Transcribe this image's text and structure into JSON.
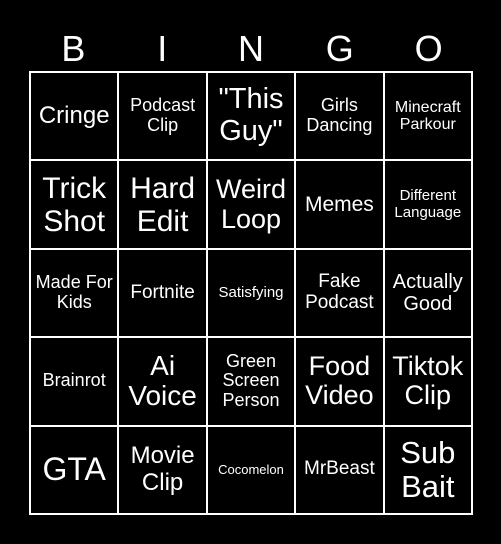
{
  "header": [
    "B",
    "I",
    "N",
    "G",
    "O"
  ],
  "cells": [
    {
      "text": "Cringe",
      "size": 24
    },
    {
      "text": "Podcast Clip",
      "size": 18
    },
    {
      "text": "\"This Guy\"",
      "size": 29
    },
    {
      "text": "Girls Dancing",
      "size": 18
    },
    {
      "text": "Minecraft Parkour",
      "size": 16
    },
    {
      "text": "Trick Shot",
      "size": 30
    },
    {
      "text": "Hard Edit",
      "size": 30
    },
    {
      "text": "Weird Loop",
      "size": 27
    },
    {
      "text": "Memes",
      "size": 21
    },
    {
      "text": "Different Language",
      "size": 15
    },
    {
      "text": "Made For Kids",
      "size": 18
    },
    {
      "text": "Fortnite",
      "size": 19
    },
    {
      "text": "Satisfying",
      "size": 15
    },
    {
      "text": "Fake Podcast",
      "size": 19
    },
    {
      "text": "Actually Good",
      "size": 20
    },
    {
      "text": "Brainrot",
      "size": 18
    },
    {
      "text": "Ai Voice",
      "size": 28
    },
    {
      "text": "Green Screen Person",
      "size": 18
    },
    {
      "text": "Food Video",
      "size": 27
    },
    {
      "text": "Tiktok Clip",
      "size": 27
    },
    {
      "text": "GTA",
      "size": 32
    },
    {
      "text": "Movie Clip",
      "size": 24
    },
    {
      "text": "Cocomelon",
      "size": 13
    },
    {
      "text": "MrBeast",
      "size": 19
    },
    {
      "text": "Sub Bait",
      "size": 31
    }
  ]
}
